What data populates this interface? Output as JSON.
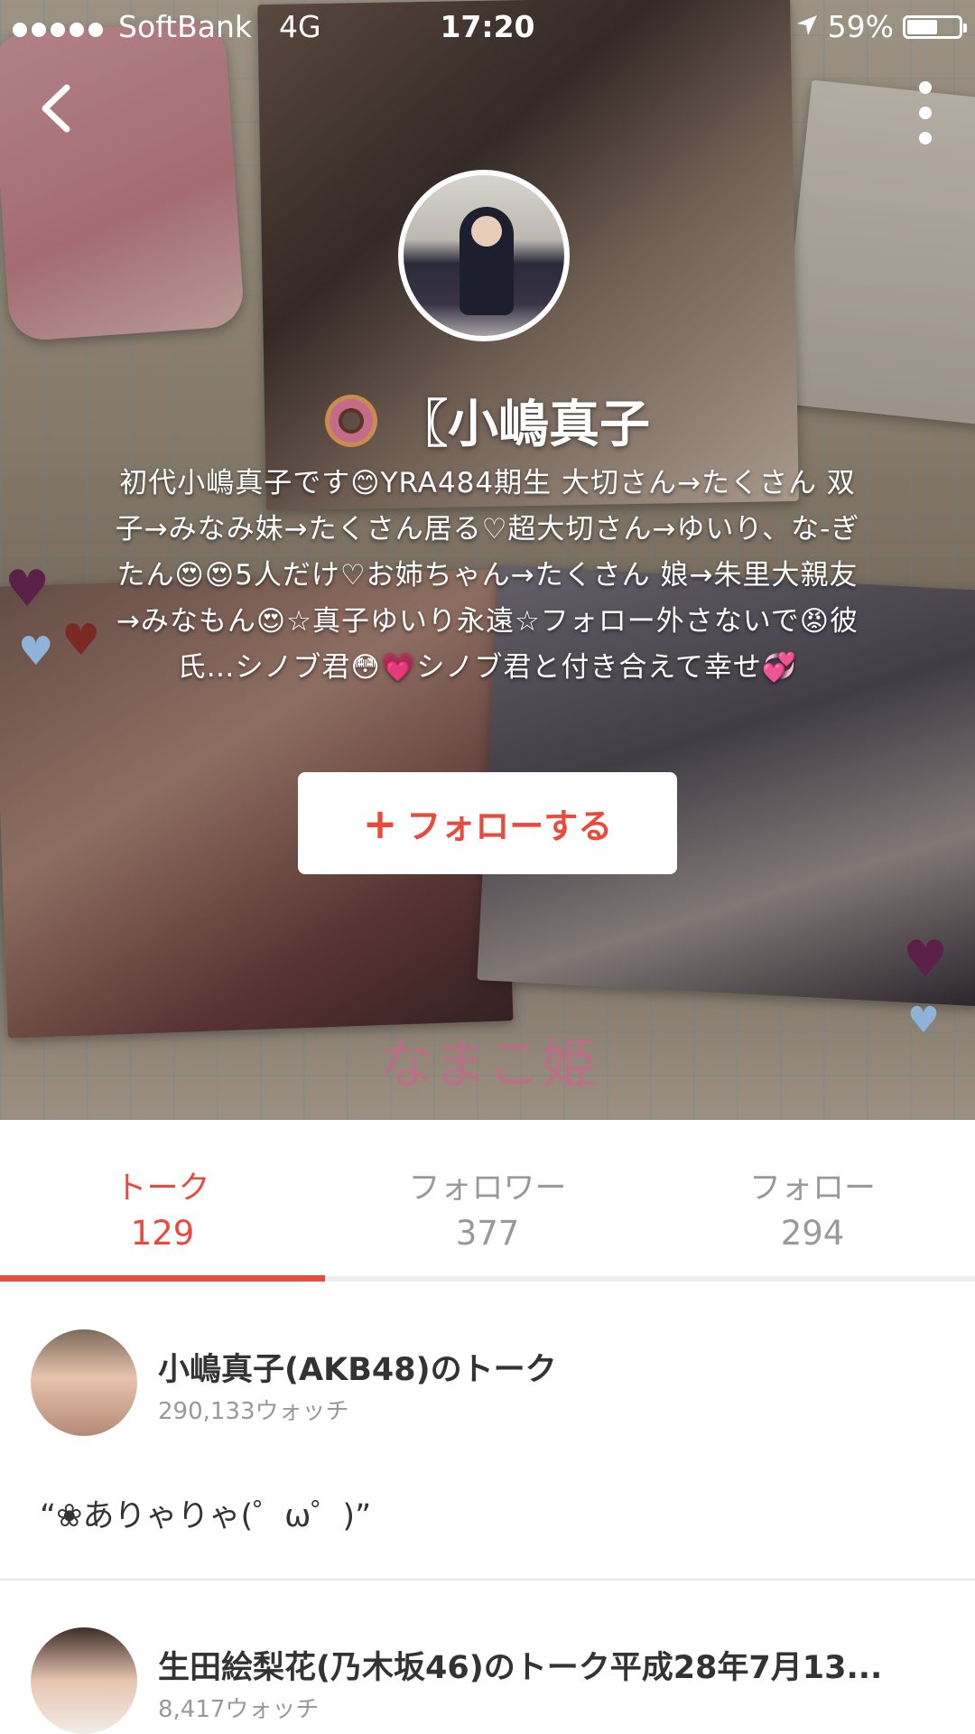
{
  "status_bar": {
    "carrier": "SoftBank",
    "network": "4G",
    "time": "17:20",
    "battery_percent": "59%",
    "battery_level": 0.59
  },
  "profile": {
    "name": "〖小嶋真子",
    "bio": "初代小嶋真子です😊YRA484期生 大切さん→たくさん 双子→みなみ妹→たくさん居る♡超大切さん→ゆいり、な-ぎたん😍😍5人だけ♡お姉ちゃん→たくさん 娘→朱里大親友→みなもん😍☆真子ゆいり永遠☆フォロー外さないで😡彼氏…シノブ君😳💗シノブ君と付き合えて幸せ💞",
    "follow_label": "フォローする",
    "follow_icon": "plus-icon",
    "cover_text": "なまこ姫"
  },
  "tabs": [
    {
      "label": "トーク",
      "count": "129",
      "active": true
    },
    {
      "label": "フォロワー",
      "count": "377",
      "active": false
    },
    {
      "label": "フォロー",
      "count": "294",
      "active": false
    }
  ],
  "talks": [
    {
      "title": "小嶋真子(AKB48)のトーク",
      "watch": "290,133ウォッチ",
      "quote": "“❀ありゃりゃ(゜ω゜)”"
    },
    {
      "title": "生田絵梨花(乃木坂46)のトーク平成28年7月13...",
      "watch": "8,417ウォッチ"
    }
  ],
  "colors": {
    "accent": "#e84b3e",
    "muted": "#999999"
  }
}
